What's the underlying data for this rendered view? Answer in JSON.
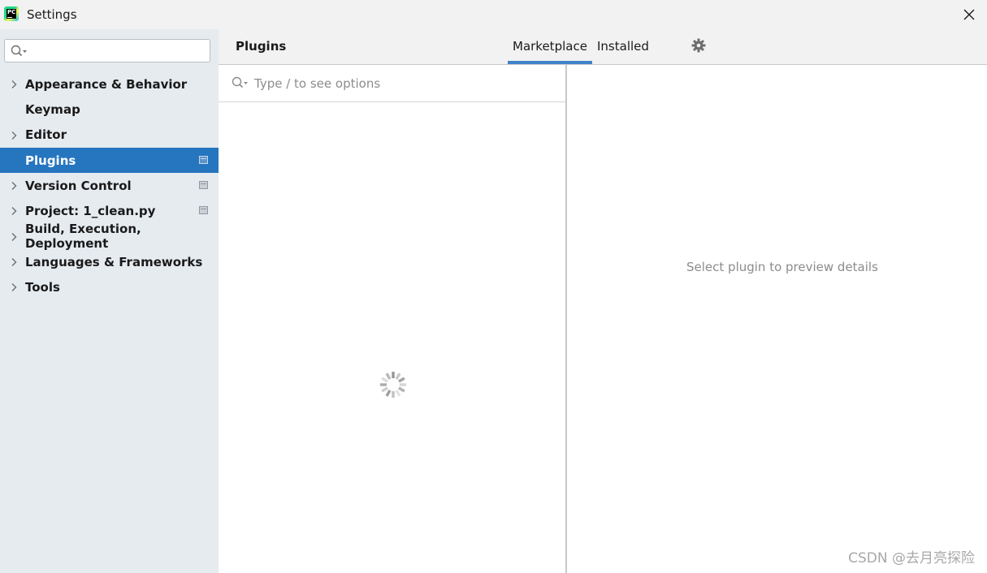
{
  "window": {
    "title": "Settings",
    "logo_text": "PC"
  },
  "sidebar": {
    "search": {
      "value": "",
      "placeholder": ""
    },
    "items": [
      {
        "label": "Appearance & Behavior",
        "expandable": true,
        "selected": false,
        "has_icon": false
      },
      {
        "label": "Keymap",
        "expandable": false,
        "selected": false,
        "has_icon": false
      },
      {
        "label": "Editor",
        "expandable": true,
        "selected": false,
        "has_icon": false
      },
      {
        "label": "Plugins",
        "expandable": false,
        "selected": true,
        "has_icon": true
      },
      {
        "label": "Version Control",
        "expandable": true,
        "selected": false,
        "has_icon": true
      },
      {
        "label": "Project: 1_clean.py",
        "expandable": true,
        "selected": false,
        "has_icon": true
      },
      {
        "label": "Build, Execution, Deployment",
        "expandable": true,
        "selected": false,
        "has_icon": false
      },
      {
        "label": "Languages & Frameworks",
        "expandable": true,
        "selected": false,
        "has_icon": false
      },
      {
        "label": "Tools",
        "expandable": true,
        "selected": false,
        "has_icon": false
      }
    ]
  },
  "main": {
    "title": "Plugins",
    "tabs": [
      {
        "label": "Marketplace",
        "active": true
      },
      {
        "label": "Installed",
        "active": false
      }
    ],
    "search": {
      "value": "",
      "placeholder": "Type / to see options"
    },
    "detail_empty_text": "Select plugin to preview details"
  },
  "watermark": "CSDN @去月亮探险",
  "icons": {
    "logo": "pycharm-logo-icon",
    "close": "close-icon",
    "search": "search-icon",
    "chevron": "chevron-right-icon",
    "project_level": "project-level-icon",
    "gear": "gear-icon",
    "spinner": "loading-spinner-icon"
  },
  "colors": {
    "selection": "#2675bf",
    "tab_underline": "#4083c9",
    "sidebar_bg": "#e6ebf0",
    "muted_text": "#8c8c8c"
  }
}
